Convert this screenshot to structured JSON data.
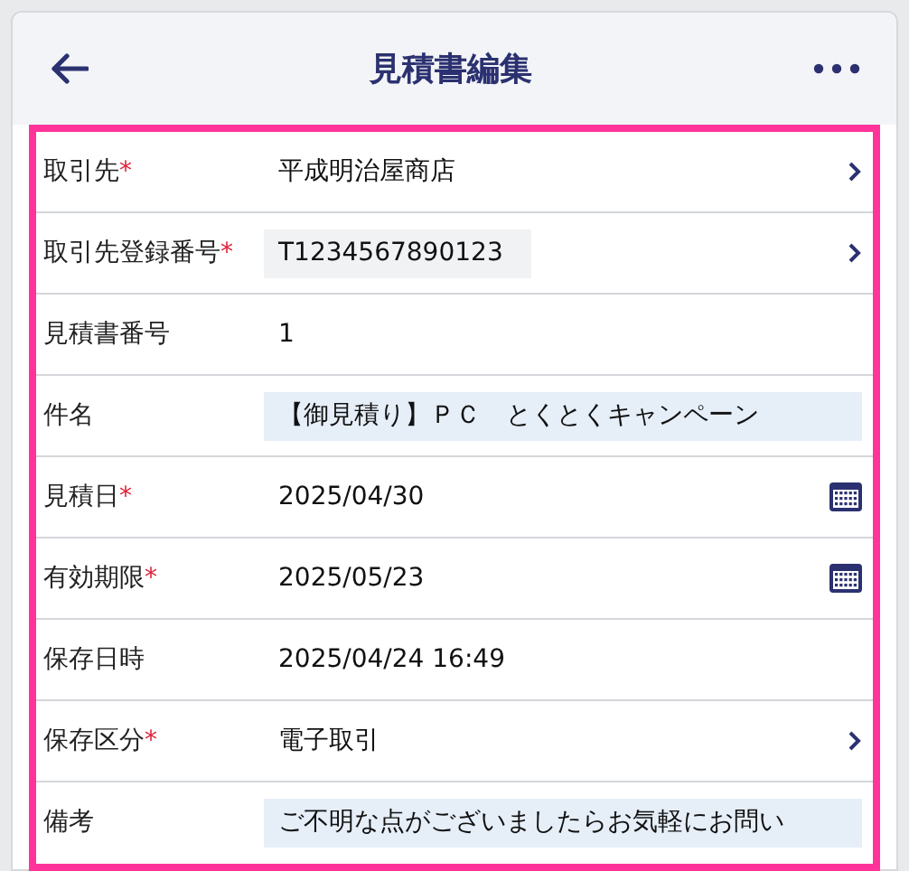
{
  "header": {
    "title": "見積書編集"
  },
  "required_mark": "*",
  "rows": [
    {
      "label": "取引先",
      "required": true,
      "value": "平成明治屋商店",
      "color": "#ffffff",
      "kind": "picker"
    },
    {
      "label": "取引先登録番号",
      "required": true,
      "value": "T1234567890123",
      "color": "#f1f2f4",
      "kind": "picker"
    },
    {
      "label": "見積書番号",
      "required": false,
      "value": "1",
      "color": "#ffffff",
      "kind": "text"
    },
    {
      "label": "件名",
      "required": false,
      "value": "【御見積り】ＰＣ　とくとくキャンペーン",
      "color": "#e6eef8",
      "kind": "input"
    },
    {
      "label": "見積日",
      "required": true,
      "value": "2025/04/30",
      "color": "#ffffff",
      "kind": "date"
    },
    {
      "label": "有効期限",
      "required": true,
      "value": "2025/05/23",
      "color": "#ffffff",
      "kind": "date"
    },
    {
      "label": "保存日時",
      "required": false,
      "value": "2025/04/24 16:49",
      "color": "#ffffff",
      "kind": "text"
    },
    {
      "label": "保存区分",
      "required": true,
      "value": "電子取引",
      "color": "#ffffff",
      "kind": "picker"
    },
    {
      "label": "備考",
      "required": false,
      "value": "ご不明な点がございましたらお気軽にお問い",
      "color": "#e6eef8",
      "kind": "input"
    }
  ]
}
